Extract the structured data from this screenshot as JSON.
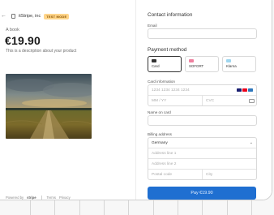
{
  "merchant": {
    "name": "itStripe, inc",
    "badge": "TEST MODE"
  },
  "product": {
    "name": "A book",
    "price": "€19.90",
    "description": "This is a description about your product"
  },
  "footer": {
    "powered_by": "Powered by",
    "brand": "stripe",
    "terms": "Terms",
    "privacy": "Privacy"
  },
  "contact": {
    "heading": "Contact information",
    "email_label": "Email",
    "email_value": ""
  },
  "payment": {
    "heading": "Payment method",
    "methods": [
      {
        "label": "Card",
        "icon": "card-icon",
        "color": "#333333",
        "selected": true
      },
      {
        "label": "SOFORT",
        "icon": "sofort-icon",
        "color": "#ef809f",
        "selected": false
      },
      {
        "label": "Klarna",
        "icon": "klarna-icon",
        "color": "#9fd6ef",
        "selected": false
      }
    ]
  },
  "card": {
    "label": "Card information",
    "number_placeholder": "1234 1234 1234 1234",
    "expiry_placeholder": "MM / YY",
    "cvc_placeholder": "CVC",
    "brand_colors": [
      "#1a1f71",
      "#eb001b",
      "#2e77bc"
    ]
  },
  "name": {
    "label": "Name on card",
    "value": ""
  },
  "billing": {
    "label": "Billing address",
    "country": "Germany",
    "line1_placeholder": "Address line 1",
    "line2_placeholder": "Address line 2",
    "postal_placeholder": "Postal code",
    "city_placeholder": "City"
  },
  "pay_button": "Pay €19.90",
  "colors": {
    "accent": "#1f6fd1",
    "badge_bg": "#ffd58a",
    "badge_text": "#8a5300"
  }
}
